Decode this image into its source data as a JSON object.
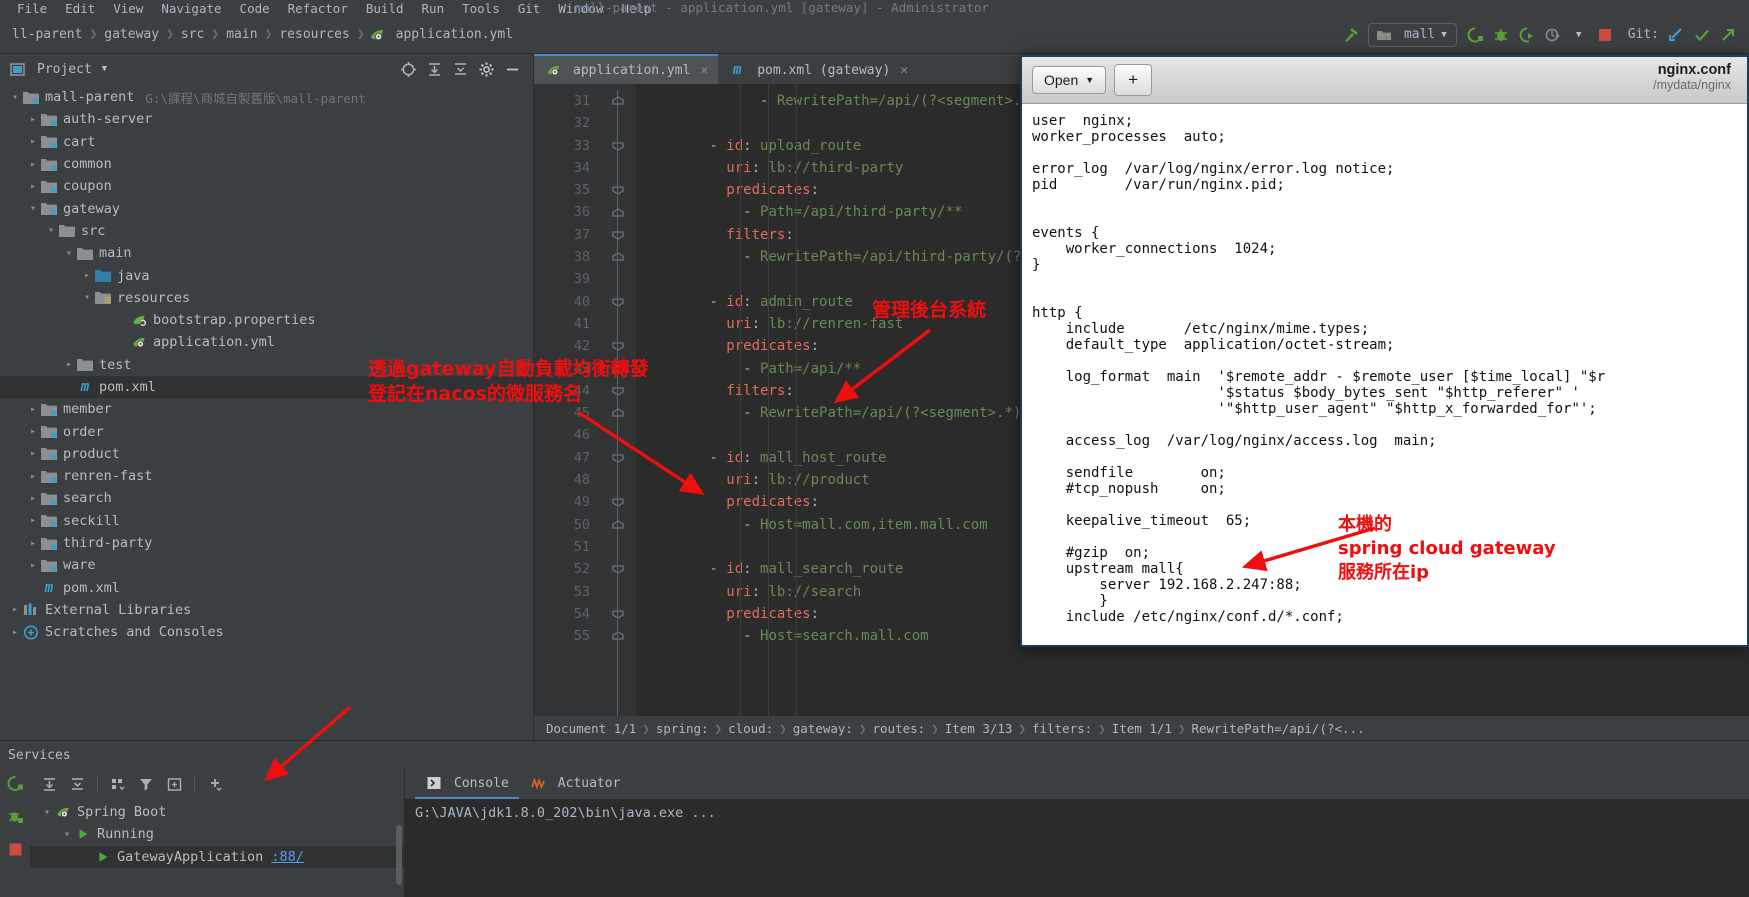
{
  "window": {
    "title": "mall-parent - application.yml [gateway] - Administrator"
  },
  "menubar": {
    "items": [
      "File",
      "Edit",
      "View",
      "Navigate",
      "Code",
      "Refactor",
      "Build",
      "Run",
      "Tools",
      "Git",
      "Window",
      "Help"
    ]
  },
  "breadcrumb": {
    "items": [
      "ll-parent",
      "gateway",
      "src",
      "main",
      "resources",
      "application.yml"
    ]
  },
  "toolbar": {
    "run_config": "mall",
    "git_label": "Git:",
    "icons": [
      "hammer-icon",
      "run-icon",
      "debug-icon",
      "run-coverage-icon",
      "profiler-icon",
      "stop-icon",
      "update-project-icon",
      "commit-icon",
      "push-icon"
    ]
  },
  "project_panel": {
    "title": "Project",
    "header_icons": [
      "locate-icon",
      "expand-all-icon",
      "collapse-all-icon",
      "settings-icon",
      "hide-icon"
    ],
    "tree": [
      {
        "label": "mall-parent",
        "path": "G:\\課程\\商城自製舊版\\mall-parent",
        "indent": 0,
        "arrow": "down",
        "icon": "module-folder-icon"
      },
      {
        "label": "auth-server",
        "path": "",
        "indent": 1,
        "arrow": "right",
        "icon": "module-folder-icon"
      },
      {
        "label": "cart",
        "path": "",
        "indent": 1,
        "arrow": "right",
        "icon": "module-folder-icon"
      },
      {
        "label": "common",
        "path": "",
        "indent": 1,
        "arrow": "right",
        "icon": "module-folder-icon"
      },
      {
        "label": "coupon",
        "path": "",
        "indent": 1,
        "arrow": "right",
        "icon": "module-folder-icon"
      },
      {
        "label": "gateway",
        "path": "",
        "indent": 1,
        "arrow": "down",
        "icon": "module-folder-icon"
      },
      {
        "label": "src",
        "path": "",
        "indent": 2,
        "arrow": "down",
        "icon": "folder-icon"
      },
      {
        "label": "main",
        "path": "",
        "indent": 3,
        "arrow": "down",
        "icon": "folder-icon"
      },
      {
        "label": "java",
        "path": "",
        "indent": 4,
        "arrow": "right",
        "icon": "source-folder-icon"
      },
      {
        "label": "resources",
        "path": "",
        "indent": 4,
        "arrow": "down",
        "icon": "resource-folder-icon"
      },
      {
        "label": "bootstrap.properties",
        "path": "",
        "indent": 6,
        "arrow": "none",
        "icon": "spring-file-icon"
      },
      {
        "label": "application.yml",
        "path": "",
        "indent": 6,
        "arrow": "none",
        "icon": "spring-yaml-icon"
      },
      {
        "label": "test",
        "path": "",
        "indent": 3,
        "arrow": "right",
        "icon": "folder-icon"
      },
      {
        "label": "pom.xml",
        "path": "",
        "indent": 3,
        "arrow": "none",
        "icon": "maven-icon",
        "selected": true
      },
      {
        "label": "member",
        "path": "",
        "indent": 1,
        "arrow": "right",
        "icon": "module-folder-icon"
      },
      {
        "label": "order",
        "path": "",
        "indent": 1,
        "arrow": "right",
        "icon": "module-folder-icon"
      },
      {
        "label": "product",
        "path": "",
        "indent": 1,
        "arrow": "right",
        "icon": "module-folder-icon"
      },
      {
        "label": "renren-fast",
        "path": "",
        "indent": 1,
        "arrow": "right",
        "icon": "module-folder-icon"
      },
      {
        "label": "search",
        "path": "",
        "indent": 1,
        "arrow": "right",
        "icon": "module-folder-icon"
      },
      {
        "label": "seckill",
        "path": "",
        "indent": 1,
        "arrow": "right",
        "icon": "module-folder-icon"
      },
      {
        "label": "third-party",
        "path": "",
        "indent": 1,
        "arrow": "right",
        "icon": "module-folder-icon"
      },
      {
        "label": "ware",
        "path": "",
        "indent": 1,
        "arrow": "right",
        "icon": "module-folder-icon"
      },
      {
        "label": "pom.xml",
        "path": "",
        "indent": 1,
        "arrow": "none",
        "icon": "maven-icon"
      },
      {
        "label": "External Libraries",
        "path": "",
        "indent": 0,
        "arrow": "right",
        "icon": "library-icon"
      },
      {
        "label": "Scratches and Consoles",
        "path": "",
        "indent": 0,
        "arrow": "right",
        "icon": "scratches-icon"
      }
    ]
  },
  "editor": {
    "tabs": [
      {
        "label": "application.yml",
        "icon": "spring-yaml-icon",
        "active": true,
        "closable": true
      },
      {
        "label": "pom.xml (gateway)",
        "icon": "maven-icon",
        "active": false,
        "closable": true
      }
    ],
    "first_line_number": 31,
    "lines": [
      {
        "n": 31,
        "text": "              - RewritePath=/api/(?<segment>.*),/$\\{s",
        "fold": "end"
      },
      {
        "n": 32,
        "text": "",
        "fold": ""
      },
      {
        "n": 33,
        "text": "        - id: upload_route",
        "fold": "start"
      },
      {
        "n": 34,
        "text": "          uri: lb://third-party",
        "fold": ""
      },
      {
        "n": 35,
        "text": "          predicates:",
        "fold": "start"
      },
      {
        "n": 36,
        "text": "            - Path=/api/third-party/**",
        "fold": "end"
      },
      {
        "n": 37,
        "text": "          filters:",
        "fold": "start"
      },
      {
        "n": 38,
        "text": "            - RewritePath=/api/third-party/(?<segme",
        "fold": "end"
      },
      {
        "n": 39,
        "text": "",
        "fold": ""
      },
      {
        "n": 40,
        "text": "        - id: admin_route",
        "fold": "start"
      },
      {
        "n": 41,
        "text": "          uri: lb://renren-fast",
        "fold": ""
      },
      {
        "n": 42,
        "text": "          predicates:",
        "fold": "start"
      },
      {
        "n": 43,
        "text": "            - Path=/api/**",
        "fold": "end"
      },
      {
        "n": 44,
        "text": "          filters:",
        "fold": "start"
      },
      {
        "n": 45,
        "text": "            - RewritePath=/api/(?<segment>.*),/renre",
        "fold": "end"
      },
      {
        "n": 46,
        "text": "",
        "fold": ""
      },
      {
        "n": 47,
        "text": "        - id: mall_host_route",
        "fold": "start"
      },
      {
        "n": 48,
        "text": "          uri: lb://product",
        "fold": ""
      },
      {
        "n": 49,
        "text": "          predicates:",
        "fold": "start"
      },
      {
        "n": 50,
        "text": "            - Host=mall.com,item.mall.com",
        "fold": "end"
      },
      {
        "n": 51,
        "text": "",
        "fold": ""
      },
      {
        "n": 52,
        "text": "        - id: mall_search_route",
        "fold": "start"
      },
      {
        "n": 53,
        "text": "          uri: lb://search",
        "fold": ""
      },
      {
        "n": 54,
        "text": "          predicates:",
        "fold": "start"
      },
      {
        "n": 55,
        "text": "            - Host=search.mall.com",
        "fold": "end"
      }
    ]
  },
  "statusbar": {
    "segments": [
      "Document 1/1",
      "spring:",
      "cloud:",
      "gateway:",
      "routes:",
      "Item 3/13",
      "filters:",
      "Item 1/1",
      "RewritePath=/api/(?<..."
    ]
  },
  "services": {
    "title": "Services",
    "toolbar_icons": [
      "rerun-icon",
      "expand-all-icon",
      "collapse-all-icon",
      "group-icon",
      "filter-icon",
      "show-in-new-window-icon",
      "add-service-icon"
    ],
    "side_icons": [
      "rerun-icon",
      "debug-icon",
      "stop-icon"
    ],
    "tree": [
      {
        "label": "Spring Boot",
        "indent": 0,
        "arrow": "down",
        "icon": "spring-boot-icon"
      },
      {
        "label": "Running",
        "indent": 1,
        "arrow": "down",
        "icon": "run-green-icon"
      },
      {
        "label": "GatewayApplication",
        "link": ":88/",
        "indent": 2,
        "arrow": "none",
        "icon": "run-green-icon",
        "selected": true
      }
    ],
    "console_tabs": [
      {
        "label": "Console",
        "icon": "console-icon",
        "active": true
      },
      {
        "label": "Actuator",
        "icon": "actuator-icon",
        "active": false
      }
    ],
    "console_output": "G:\\JAVA\\jdk1.8.0_202\\bin\\java.exe ..."
  },
  "gedit": {
    "open_button": "Open",
    "plus_button": "+",
    "title": "nginx.conf",
    "subtitle": "/mydata/nginx",
    "lines": [
      "user  nginx;",
      "worker_processes  auto;",
      "",
      "error_log  /var/log/nginx/error.log notice;",
      "pid        /var/run/nginx.pid;",
      "",
      "",
      "events {",
      "    worker_connections  1024;",
      "}",
      "",
      "",
      "http {",
      "    include       /etc/nginx/mime.types;",
      "    default_type  application/octet-stream;",
      "",
      "    log_format  main  '$remote_addr - $remote_user [$time_local] \"$r",
      "                      '$status $body_bytes_sent \"$http_referer\" '",
      "                      '\"$http_user_agent\" \"$http_x_forwarded_for\"';",
      "",
      "    access_log  /var/log/nginx/access.log  main;",
      "",
      "    sendfile        on;",
      "    #tcp_nopush     on;",
      "",
      "    keepalive_timeout  65;",
      "",
      "    #gzip  on;",
      "    upstream mall{",
      "        server 192.168.2.247:88;",
      "        }",
      "    include /etc/nginx/conf.d/*.conf;"
    ]
  },
  "annotations": [
    {
      "id": "anno-admin-route",
      "text": "管理後台系統",
      "color": "#ef0e0e"
    },
    {
      "id": "anno-gateway-lb",
      "text": "透過gateway自動負載均衡轉發\n登記在nacos的微服務名",
      "color": "#ef0e0e"
    },
    {
      "id": "anno-local-ip",
      "text": "本機的\nspring cloud gateway\n服務所在ip",
      "color": "#ef0e0e"
    }
  ]
}
